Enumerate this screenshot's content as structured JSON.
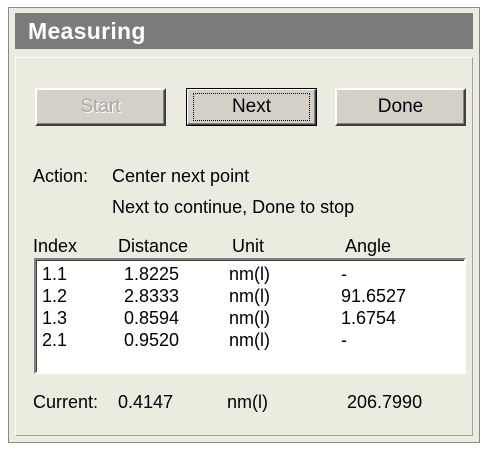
{
  "window": {
    "title": "Measuring"
  },
  "buttons": {
    "start": "Start",
    "next": "Next",
    "done": "Done"
  },
  "action": {
    "label": "Action:",
    "line1": "Center next point",
    "line2": "Next to continue, Done to stop"
  },
  "list": {
    "columns": {
      "index": "Index",
      "distance": "Distance",
      "unit": "Unit",
      "angle": "Angle"
    },
    "rows": [
      {
        "index": "1.1",
        "distance": "1.8225",
        "unit": "nm(l)",
        "angle": "-"
      },
      {
        "index": "1.2",
        "distance": "2.8333",
        "unit": "nm(l)",
        "angle": "91.6527"
      },
      {
        "index": "1.3",
        "distance": "0.8594",
        "unit": "nm(l)",
        "angle": "1.6754"
      },
      {
        "index": "2.1",
        "distance": "0.9520",
        "unit": "nm(l)",
        "angle": "-"
      }
    ]
  },
  "current": {
    "label": "Current:",
    "distance": "0.4147",
    "unit": "nm(l)",
    "angle": "206.7990"
  }
}
